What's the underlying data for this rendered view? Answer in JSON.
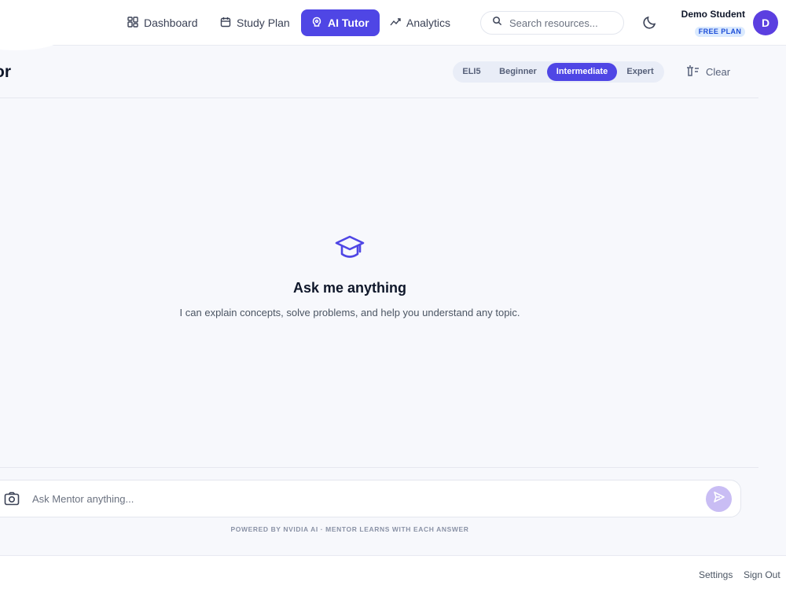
{
  "nav": {
    "items": [
      {
        "label": "Dashboard",
        "icon": "grid-icon"
      },
      {
        "label": "Study Plan",
        "icon": "calendar-icon"
      },
      {
        "label": "AI Tutor",
        "icon": "brain-icon",
        "active": true
      },
      {
        "label": "Analytics",
        "icon": "trend-icon"
      }
    ],
    "search_placeholder": "Search resources..."
  },
  "user": {
    "name": "Demo Student",
    "plan": "FREE PLAN",
    "initial": "D"
  },
  "header": {
    "title": "tor",
    "levels": [
      "ELI5",
      "Beginner",
      "Intermediate",
      "Expert"
    ],
    "selected_level": "Intermediate",
    "clear_label": "Clear"
  },
  "empty_state": {
    "title": "Ask me anything",
    "subtitle": "I can explain concepts, solve problems, and help you understand any topic."
  },
  "composer": {
    "placeholder": "Ask Mentor anything...",
    "footer": "POWERED BY NVIDIA AI · MENTOR LEARNS WITH EACH ANSWER"
  },
  "bottom": {
    "settings": "Settings",
    "sign_out": "Sign Out"
  },
  "colors": {
    "accent": "#4f46e5",
    "background": "#f7f8fc",
    "send_disabled": "#c9bdf4"
  }
}
